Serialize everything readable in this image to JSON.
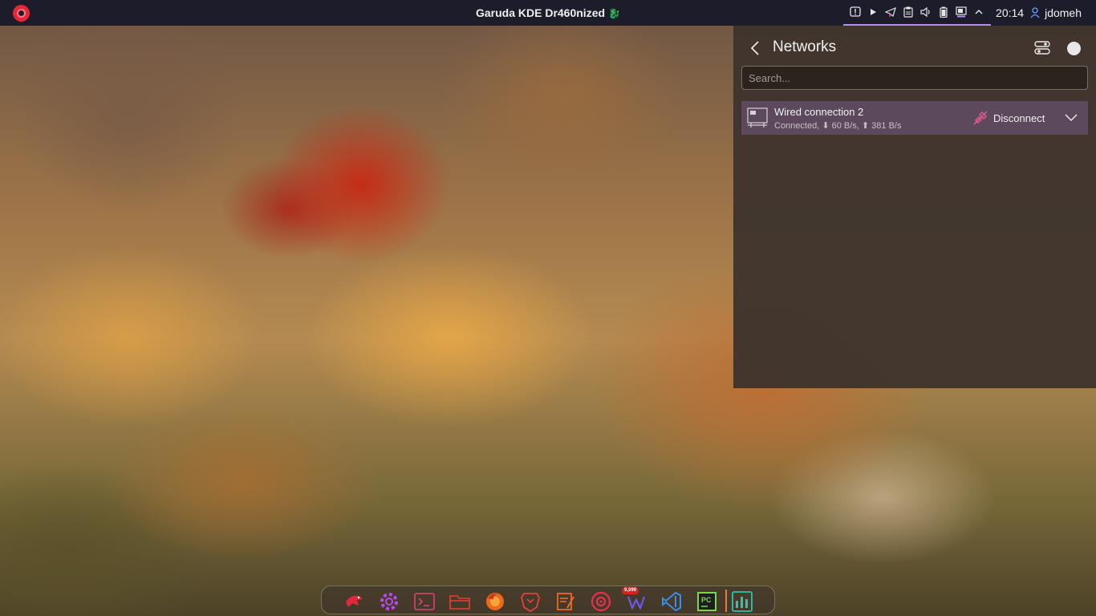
{
  "top_panel": {
    "window_title": "Garuda KDE Dr460nized",
    "tray_icons": [
      "notifications-icon",
      "media-play-icon",
      "telegram-icon",
      "clipboard-icon",
      "volume-icon",
      "battery-icon",
      "network-icon",
      "tray-expand-icon"
    ],
    "clock": "20:14",
    "username": "jdomeh"
  },
  "networks": {
    "title": "Networks",
    "search_placeholder": "Search...",
    "connection": {
      "name": "Wired connection 2",
      "status": "Connected, ⬇ 60 B/s, ⬆ 381 B/s",
      "action_label": "Disconnect"
    }
  },
  "dock": {
    "apps": [
      "garuda-launcher",
      "settings",
      "terminal",
      "file-manager",
      "firefox",
      "brave",
      "text-editor",
      "music-player",
      "writer",
      "vscode",
      "pycharm",
      "system-monitor"
    ],
    "badge": "9,999"
  },
  "colors": {
    "panel_bg": "#1c1c2a",
    "accent": "#b38cf0",
    "selected_row": "#5c4a5c",
    "disconnect_icon": "#e25c8c"
  }
}
